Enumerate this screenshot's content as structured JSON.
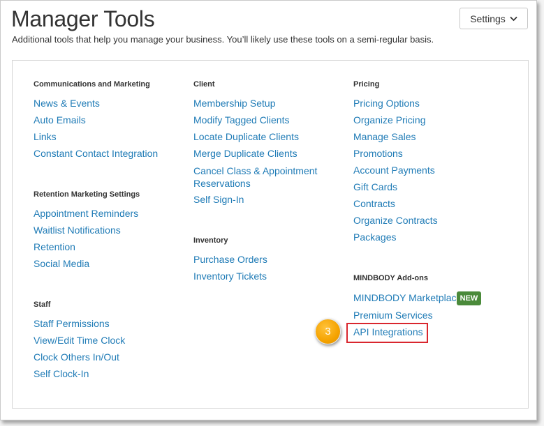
{
  "header": {
    "title": "Manager Tools",
    "subtitle": "Additional tools that help you manage your business. You’ll likely use these tools on a semi-regular basis.",
    "settings_label": "Settings"
  },
  "sections": {
    "communications": {
      "heading": "Communications and Marketing",
      "links": [
        "News & Events",
        "Auto Emails",
        "Links",
        "Constant Contact Integration"
      ]
    },
    "retention": {
      "heading": "Retention Marketing Settings",
      "links": [
        "Appointment Reminders",
        "Waitlist Notifications",
        "Retention",
        "Social Media"
      ]
    },
    "staff": {
      "heading": "Staff",
      "links": [
        "Staff Permissions",
        "View/Edit Time Clock",
        "Clock Others In/Out",
        "Self Clock-In"
      ]
    },
    "client": {
      "heading": "Client",
      "links": [
        "Membership Setup",
        "Modify Tagged Clients",
        "Locate Duplicate Clients",
        "Merge Duplicate Clients",
        "Cancel Class & Appointment Reservations",
        "Self Sign-In"
      ]
    },
    "inventory": {
      "heading": "Inventory",
      "links": [
        "Purchase Orders",
        "Inventory Tickets"
      ]
    },
    "pricing": {
      "heading": "Pricing",
      "links": [
        "Pricing Options",
        "Organize Pricing",
        "Manage Sales",
        "Promotions",
        "Account Payments",
        "Gift Cards",
        "Contracts",
        "Organize Contracts",
        "Packages"
      ]
    },
    "addons": {
      "heading": "MINDBODY Add-ons",
      "links": [
        "MINDBODY Marketplace",
        "Premium Services",
        "API Integrations"
      ],
      "badge": "NEW"
    }
  },
  "annotation": {
    "step_number": "3",
    "highlight_color": "#d9262e",
    "marker_color": "#f5a300"
  },
  "colors": {
    "link": "#1f7bb6",
    "badge": "#4a8a3a"
  }
}
